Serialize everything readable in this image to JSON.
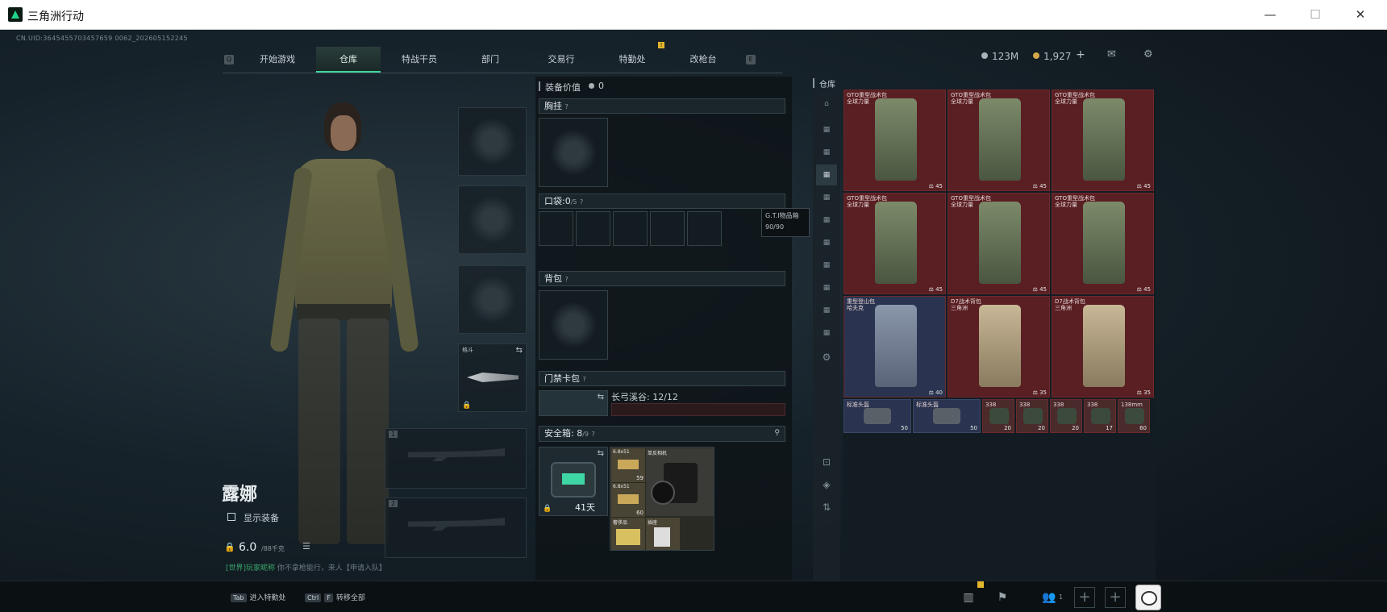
{
  "window": {
    "title": "三角洲行动",
    "minimize": "—",
    "maximize": "☐",
    "close": "✕"
  },
  "uid": "CN.UID:3645455703457659 0062_202605152245",
  "nav": {
    "left_key": "Q",
    "right_key": "E",
    "tabs": [
      {
        "label": "开始游戏",
        "active": false
      },
      {
        "label": "仓库",
        "active": true
      },
      {
        "label": "特战干员",
        "active": false
      },
      {
        "label": "部门",
        "active": false
      },
      {
        "label": "交易行",
        "active": false
      },
      {
        "label": "特勤处",
        "active": false,
        "badge": "!"
      },
      {
        "label": "改枪台",
        "active": false
      }
    ]
  },
  "currency": {
    "silver": "123M",
    "gold": "1,927",
    "plus": "+"
  },
  "character": {
    "name": "露娜",
    "show_equipment": "显示装备",
    "weight": "6.0",
    "weight_max": "/88千克"
  },
  "chat": {
    "prefix": "[世界]",
    "sender": "玩家昵称",
    "message": "你不拿枪能行，来人【申请入队】"
  },
  "slots": {
    "melee_label": "格斗",
    "weapon1": "1",
    "weapon2": "2"
  },
  "equip": {
    "value_label": "装备价值",
    "value": "0",
    "chest": "胸挂",
    "pocket": "口袋:",
    "pocket_count": "0",
    "pocket_max": "/5",
    "backpack": "背包",
    "keycard": "门禁卡包",
    "keycard_item": "长弓溪谷: 12/12",
    "safe": "安全箱:",
    "safe_count": "8",
    "safe_max": "/9",
    "safe_timer": "41天",
    "safe_items": [
      {
        "name": "6.8x51",
        "count": "59"
      },
      {
        "name": "单反相机",
        "count": ""
      },
      {
        "name": "6.8x51",
        "count": "60"
      },
      {
        "name": "奢侈品",
        "count": ""
      },
      {
        "name": "插座",
        "count": ""
      }
    ]
  },
  "tooltip": {
    "title": "G.T.I物品箱",
    "value": "90/90"
  },
  "stash": {
    "title": "仓库",
    "items": [
      {
        "name": "GTO重型战术包",
        "sub": "全球力量",
        "count": "45",
        "tone": "red"
      },
      {
        "name": "GTO重型战术包",
        "sub": "全球力量",
        "count": "45",
        "tone": "red"
      },
      {
        "name": "GTO重型战术包",
        "sub": "全球力量",
        "count": "45",
        "tone": "red"
      },
      {
        "name": "GTO重型战术包",
        "sub": "全球力量",
        "count": "45",
        "tone": "red"
      },
      {
        "name": "GTO重型战术包",
        "sub": "全球力量",
        "count": "45",
        "tone": "red"
      },
      {
        "name": "GTO重型战术包",
        "sub": "全球力量",
        "count": "45",
        "tone": "red"
      },
      {
        "name": "重型登山包",
        "sub": "哈夫克",
        "count": "40",
        "tone": "blue"
      },
      {
        "name": "D7战术背包",
        "sub": "三角洲",
        "count": "35",
        "tone": "red"
      },
      {
        "name": "D7战术背包",
        "sub": "三角洲",
        "count": "35",
        "tone": "red"
      }
    ],
    "small": [
      {
        "name": "标准头盔",
        "count": "50"
      },
      {
        "name": "标准头盔",
        "count": "50"
      },
      {
        "name": "338",
        "count": "20"
      },
      {
        "name": "338",
        "count": "20"
      },
      {
        "name": "338",
        "count": "20"
      },
      {
        "name": "338",
        "count": "17"
      },
      {
        "name": "138mm",
        "count": "60"
      }
    ]
  },
  "bottom": {
    "tab_key": "Tab",
    "tab_label": "进入特勤处",
    "ctrl_key": "Ctrl",
    "f_key": "F",
    "ctrl_label": "转移全部",
    "friends": "1"
  }
}
